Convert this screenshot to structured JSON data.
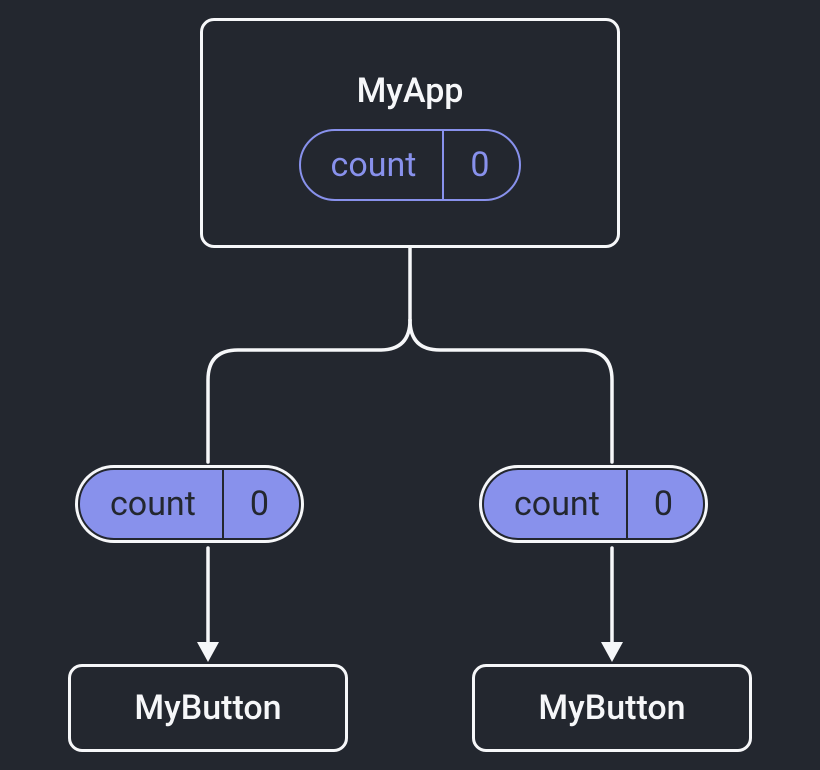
{
  "root": {
    "title": "MyApp",
    "state_label": "count",
    "state_value": "0"
  },
  "props": [
    {
      "label": "count",
      "value": "0"
    },
    {
      "label": "count",
      "value": "0"
    }
  ],
  "children": [
    {
      "title": "MyButton"
    },
    {
      "title": "MyButton"
    }
  ]
}
